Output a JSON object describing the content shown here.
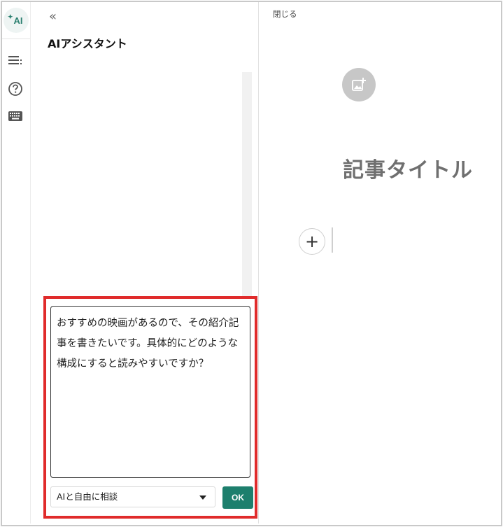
{
  "rail": {
    "ai_badge": "AI",
    "icons": [
      "menu-lines-icon",
      "help-circle-icon",
      "keyboard-icon"
    ]
  },
  "assistant": {
    "collapse_glyph": "«",
    "title": "AIアシスタント",
    "prompt_text": "おすすめの映画があるので、その紹介記事を書きたいです。具体的にどのような構成にすると読みやすいですか？",
    "mode_select": "AIと自由に相談",
    "ok_label": "OK"
  },
  "editor": {
    "close_label": "閉じる",
    "title_placeholder": "記事タイトル",
    "add_block_glyph": "+"
  },
  "colors": {
    "accent": "#1d7f6d",
    "highlight_border": "#e02b2b",
    "title_placeholder": "#6f6f6f"
  }
}
